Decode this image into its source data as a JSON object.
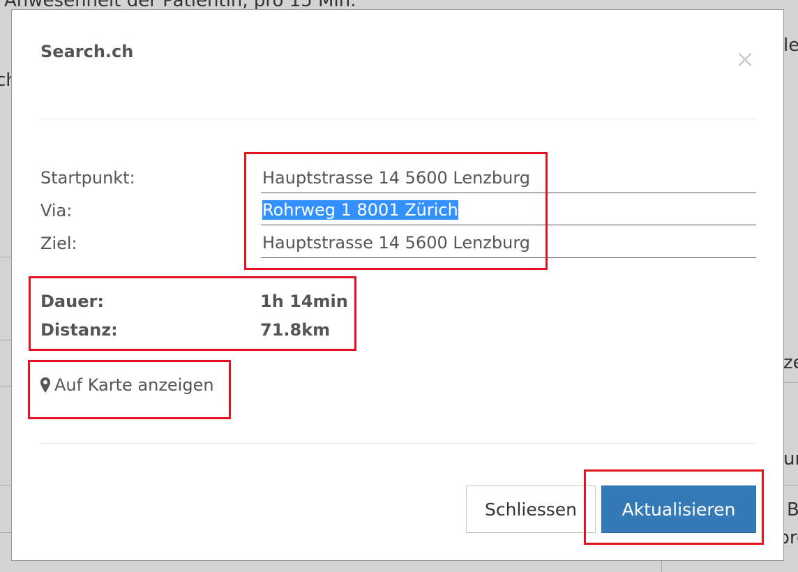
{
  "background": {
    "top_text": "Anwesenheit der Patientin, pro 15 Min.",
    "right_text_1": "le",
    "left_text_1": "ch",
    "right_text_2": "ze",
    "right_text_3": "ur",
    "right_text_4": "B",
    "right_text_5": "ore"
  },
  "modal": {
    "title": "Search.ch",
    "close_icon": "×",
    "fields": [
      {
        "label": "Startpunkt:",
        "value": "Hauptstrasse 14 5600 Lenzburg"
      },
      {
        "label": "Via:",
        "value": "Rohrweg 1 8001 Zürich"
      },
      {
        "label": "Ziel:",
        "value": "Hauptstrasse 14 5600 Lenzburg"
      }
    ],
    "stats": {
      "duration_label": "Dauer:",
      "duration_value": "1h 14min",
      "distance_label": "Distanz:",
      "distance_value": "71.8km"
    },
    "map_link": "Auf Karte anzeigen",
    "close_button": "Schliessen",
    "update_button": "Aktualisieren"
  },
  "colors": {
    "primary_button": "#337ab7",
    "selection": "#3390ff",
    "annotation": "#e3141f"
  }
}
